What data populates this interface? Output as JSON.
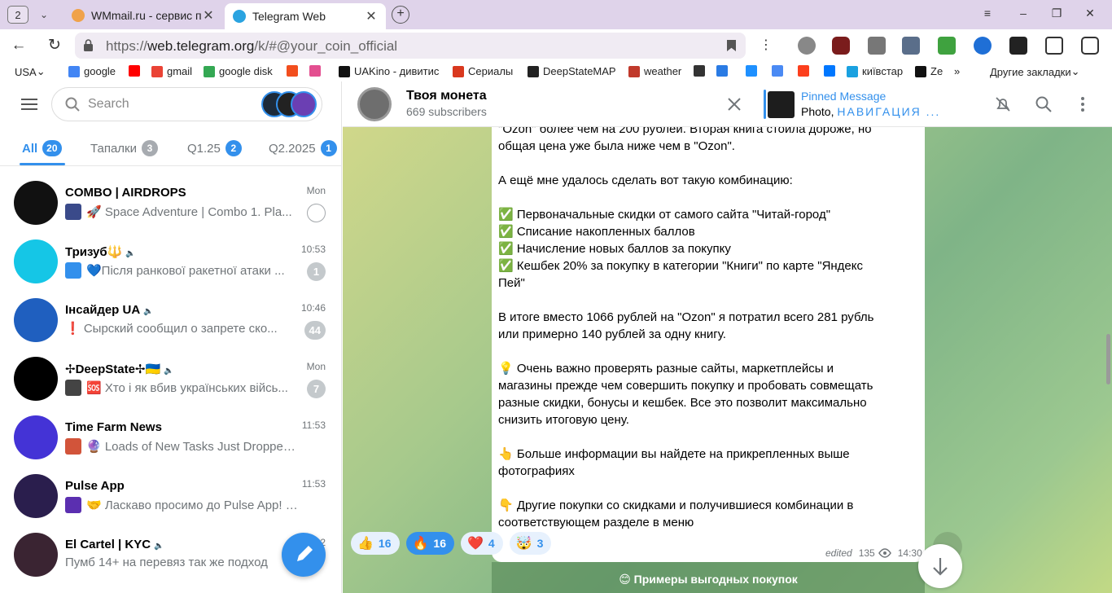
{
  "browser": {
    "tab_count": "2",
    "tabs": [
      {
        "title": "WMmail.ru - сервис почтового",
        "active": false
      },
      {
        "title": "Telegram Web",
        "active": true
      }
    ],
    "url_prefix": "https://",
    "url_host": "web.telegram.org",
    "url_rest": "/k/#@your_coin_official",
    "bookmarks": [
      {
        "label": "USA",
        "icon_color": "#ffffff"
      },
      {
        "label": "google",
        "icon_color": "#4285f4"
      },
      {
        "label": "",
        "icon_color": "#ff0000"
      },
      {
        "label": "gmail",
        "icon_color": "#ea4335"
      },
      {
        "label": "google disk",
        "icon_color": "#34a853"
      },
      {
        "label": "",
        "icon_color": "#f24e1e"
      },
      {
        "label": "",
        "icon_color": "#e34f90"
      },
      {
        "label": "UAKino - дивитис",
        "icon_color": "#111111"
      },
      {
        "label": "Сериалы",
        "icon_color": "#d9381e"
      },
      {
        "label": "DeepStateMAP",
        "icon_color": "#222222"
      },
      {
        "label": "weather",
        "icon_color": "#c0392b"
      },
      {
        "label": "",
        "icon_color": "#333333"
      },
      {
        "label": "",
        "icon_color": "#2a7be4"
      },
      {
        "label": "",
        "icon_color": "#1e90ff"
      },
      {
        "label": "",
        "icon_color": "#4a8af4"
      },
      {
        "label": "",
        "icon_color": "#fc3f1d"
      },
      {
        "label": "",
        "icon_color": "#0077ff"
      },
      {
        "label": "київстар",
        "icon_color": "#1aa1e0"
      },
      {
        "label": "Ze",
        "icon_color": "#111111"
      },
      {
        "label": "»",
        "icon_color": ""
      },
      {
        "label": "Другие закладки",
        "icon_color": ""
      }
    ]
  },
  "sidebar": {
    "search_placeholder": "Search",
    "folders": [
      {
        "label": "All",
        "count": "20",
        "active": true
      },
      {
        "label": "Тапалки",
        "count": "3",
        "active": false
      },
      {
        "label": "Q1.25",
        "count": "2",
        "active": false
      },
      {
        "label": "Q2.2025",
        "count": "1",
        "active": false
      }
    ],
    "chats": [
      {
        "name": "COMBO | AIRDROPS",
        "time": "Mon",
        "preview": "🚀 Space Adventure | Combo 1. Pla...",
        "badge": "",
        "pinned": true,
        "muted": false,
        "avatar_color": "#111111",
        "thumb_color": "#3a4a8a"
      },
      {
        "name": "Тризуб🔱",
        "time": "10:53",
        "preview": "💙Після ранкової ракетної атаки ...",
        "badge": "1",
        "pinned": false,
        "muted": true,
        "avatar_color": "#15c6e6",
        "thumb_color": "#3390ec"
      },
      {
        "name": "Інсайдер UA",
        "time": "10:46",
        "preview": "❗ Сырский сообщил о запрете ско...",
        "badge": "44",
        "pinned": false,
        "muted": true,
        "avatar_color": "#1f5fbf",
        "thumb_color": ""
      },
      {
        "name": "✢DeepState✢🇺🇦",
        "time": "Mon",
        "preview": "🆘 Хто і як вбив українських війсь...",
        "badge": "7",
        "pinned": false,
        "muted": true,
        "avatar_color": "#000000",
        "thumb_color": "#444444"
      },
      {
        "name": "Time Farm News",
        "time": "11:53",
        "preview": "🔮 Loads of New Tasks Just Dropped ...",
        "badge": "",
        "pinned": false,
        "muted": false,
        "avatar_color": "#4433d6",
        "thumb_color": "#d2543a"
      },
      {
        "name": "Pulse App",
        "time": "11:53",
        "preview": "🤝 Ласкаво просимо до Pulse App! 🔒...",
        "badge": "",
        "pinned": false,
        "muted": false,
        "avatar_color": "#2a1e4d",
        "thumb_color": "#5b2fb0"
      },
      {
        "name": "El Cartel | KYC",
        "time": "2",
        "preview": "Пумб 14+ на перевяз так же подход",
        "badge": "",
        "pinned": false,
        "muted": true,
        "avatar_color": "#3a2432",
        "thumb_color": ""
      }
    ]
  },
  "channel": {
    "title": "Твоя монета",
    "subscribers": "669 subscribers",
    "pinned_title": "Pinned Message",
    "pinned_prefix": "Photo, ",
    "pinned_text": "НАВИГАЦИЯ ..."
  },
  "message": {
    "lines": [
      "\"Ozon\" более чем на 200 рублей. Вторая книга стоила дороже, но",
      "общая цена уже была ниже чем в \"Ozon\".",
      "",
      "А ещё мне удалось сделать вот такую комбинацию:",
      "",
      "✅  Первоначальные скидки от самого сайта \"Читай-город\"",
      "✅ Списание накопленных баллов",
      "✅ Начисление новых баллов за покупку",
      "✅ Кешбек 20% за покупку в категории \"Книги\" по карте \"Яндекс",
      "Пей\"",
      "",
      "В итоге вместо 1066 рублей на \"Ozon\" я потратил всего 281 рубль",
      "или примерно 140 рублей за одну книгу.",
      "",
      "💡 Очень важно проверять разные сайты, маркетплейсы и",
      "магазины прежде чем совершить покупку и пробовать совмещать",
      "разные скидки, бонусы и кешбек. Все это позволит максимально",
      "снизить итоговую цену.",
      "",
      "👆 Больше информации вы найдете на прикрепленных выше",
      "фотографиях",
      "",
      "👇 Другие покупки со скидками и получившиеся комбинации в",
      "соответствующем разделе в меню"
    ],
    "reactions": [
      {
        "emoji": "👍",
        "count": "16",
        "selected": false
      },
      {
        "emoji": "🔥",
        "count": "16",
        "selected": true
      },
      {
        "emoji": "❤️",
        "count": "4",
        "selected": false
      },
      {
        "emoji": "🤯",
        "count": "3",
        "selected": false
      }
    ],
    "edited": "edited",
    "views": "135",
    "time": "14:30",
    "bottom_button": "😊 Примеры выгодных покупок"
  }
}
